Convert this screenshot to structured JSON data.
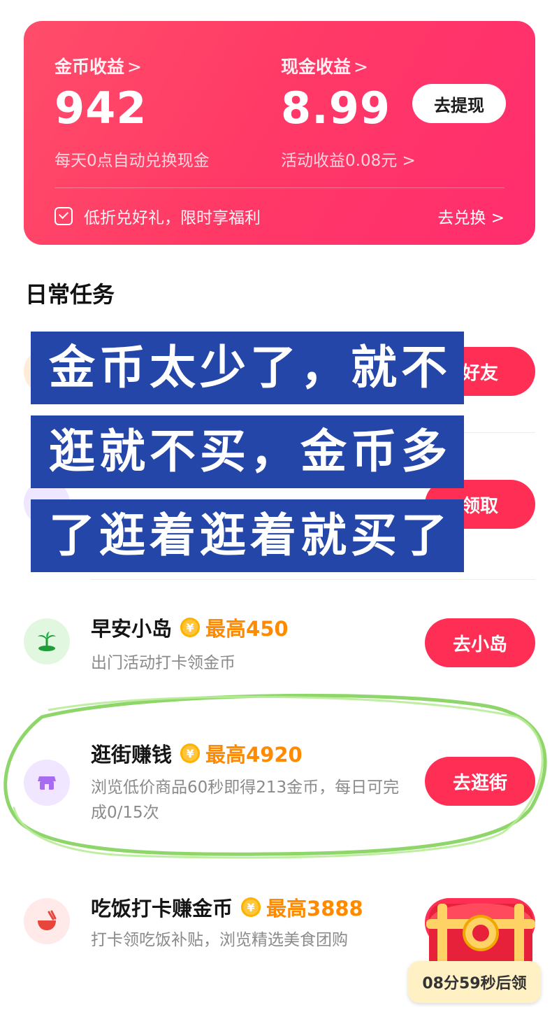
{
  "earnings": {
    "coins_label": "金币收益",
    "coins_value": "942",
    "coins_note": "每天0点自动兑换现金",
    "cash_label": "现金收益",
    "cash_value": "8.99",
    "cash_note": "活动收益0.08元",
    "withdraw_label": "去提现",
    "promo_text": "低折兑好礼，限时享福利",
    "redeem_label": "去兑换"
  },
  "section_title": "日常任务",
  "overlay_lines": [
    "金币太少了，就不",
    "逛就不买，金币多",
    "了逛着逛着就买了"
  ],
  "hidden_buttons": [
    "好友",
    "领取"
  ],
  "tasks": [
    {
      "title": "早安小岛",
      "coin_symbol": "¥",
      "max": "最高450",
      "desc": "出门活动打卡领金币",
      "button": "去小岛",
      "icon": "palm-tree-icon",
      "icon_bg": "#e2f7e0"
    },
    {
      "title": "逛街赚钱",
      "coin_symbol": "¥",
      "max": "最高4920",
      "desc": "浏览低价商品60秒即得213金币，每日可完成0/15次",
      "button": "去逛街",
      "icon": "shop-icon",
      "icon_bg": "#f1e6ff"
    },
    {
      "title": "吃饭打卡赚金币",
      "coin_symbol": "¥",
      "max": "最高3888",
      "desc": "打卡领吃饭补贴，浏览精选美食团购",
      "button": "",
      "icon": "bowl-icon",
      "icon_bg": "#ffe9e9"
    }
  ],
  "chest_timer": "08分59秒后领",
  "colors": {
    "card_gradient_start": "#ff4d6a",
    "card_gradient_end": "#ff2d6e",
    "button_red": "#ff2e55",
    "accent_orange": "#ff8a00",
    "overlay_blue": "#2446a8",
    "highlight_green": "#8fd66a"
  }
}
